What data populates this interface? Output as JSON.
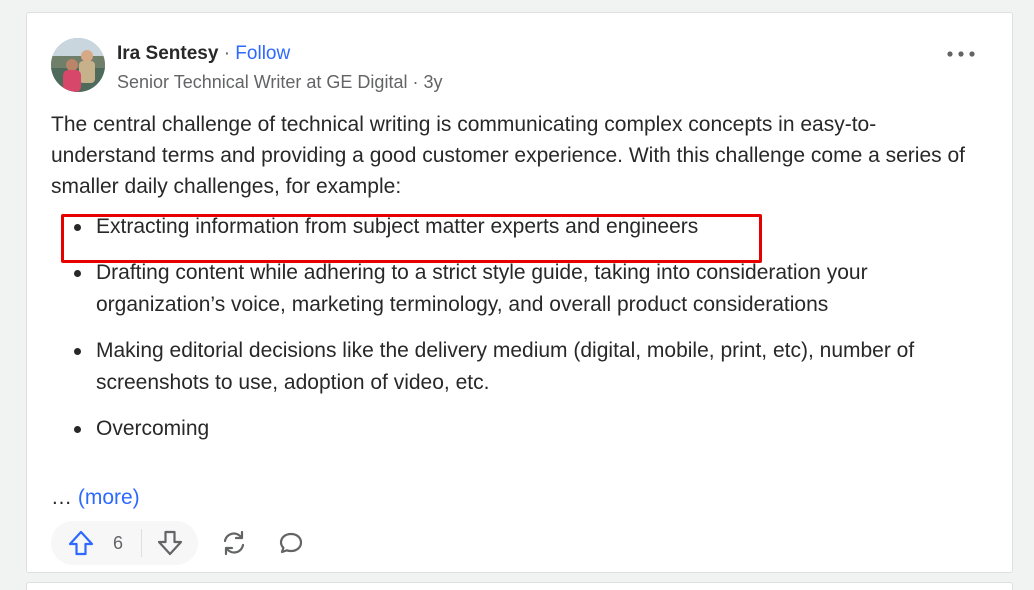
{
  "answer": {
    "author": {
      "name": "Ira Sentesy",
      "separator": "·",
      "follow_label": "Follow",
      "credential": "Senior Technical Writer at GE Digital · 3y"
    },
    "intro": "The central challenge of technical writing is communicating complex concepts in easy-to-understand terms and providing a good customer experience. With this challenge come a series of smaller daily challenges, for example:",
    "points": [
      "Extracting information from subject matter experts and engineers",
      "Drafting content while adhering to a strict style guide, taking into consideration your organization’s voice, marketing terminology, and overall product considerations",
      "Making editorial decisions like the delivery medium (digital, mobile, print, etc), number of screenshots to use, adoption of video, etc.",
      "Overcoming"
    ],
    "ellipsis": "…",
    "more_label": "(more)",
    "upvote_count": "6"
  },
  "colors": {
    "accent": "#2e69ff",
    "highlight_box": "#e60000",
    "text": "#282829",
    "muted": "#636466"
  },
  "icons": [
    "avatar-photo",
    "more-horizontal-icon",
    "upvote-arrow-icon",
    "downvote-arrow-icon",
    "share-icon",
    "comment-icon"
  ]
}
